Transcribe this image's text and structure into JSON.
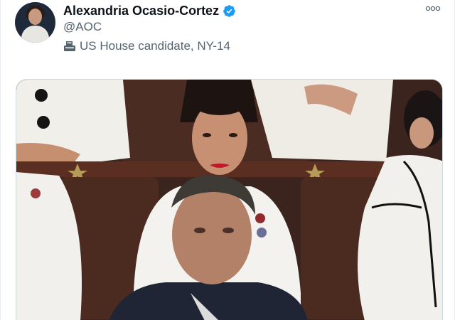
{
  "tweet": {
    "author": {
      "display_name": "Alexandria Ocasio-Cortez",
      "handle": "@AOC",
      "verified_icon": "verified-badge-icon",
      "bio": "US House candidate, NY-14",
      "bio_icon": "ballot-box-icon",
      "avatar_icon": "profile-avatar"
    },
    "more_icon": "more-options-icon"
  },
  "colors": {
    "verified_blue": "#1d9bf0",
    "secondary_text": "#536471",
    "primary_text": "#0f1419",
    "border": "#cfd9de"
  }
}
